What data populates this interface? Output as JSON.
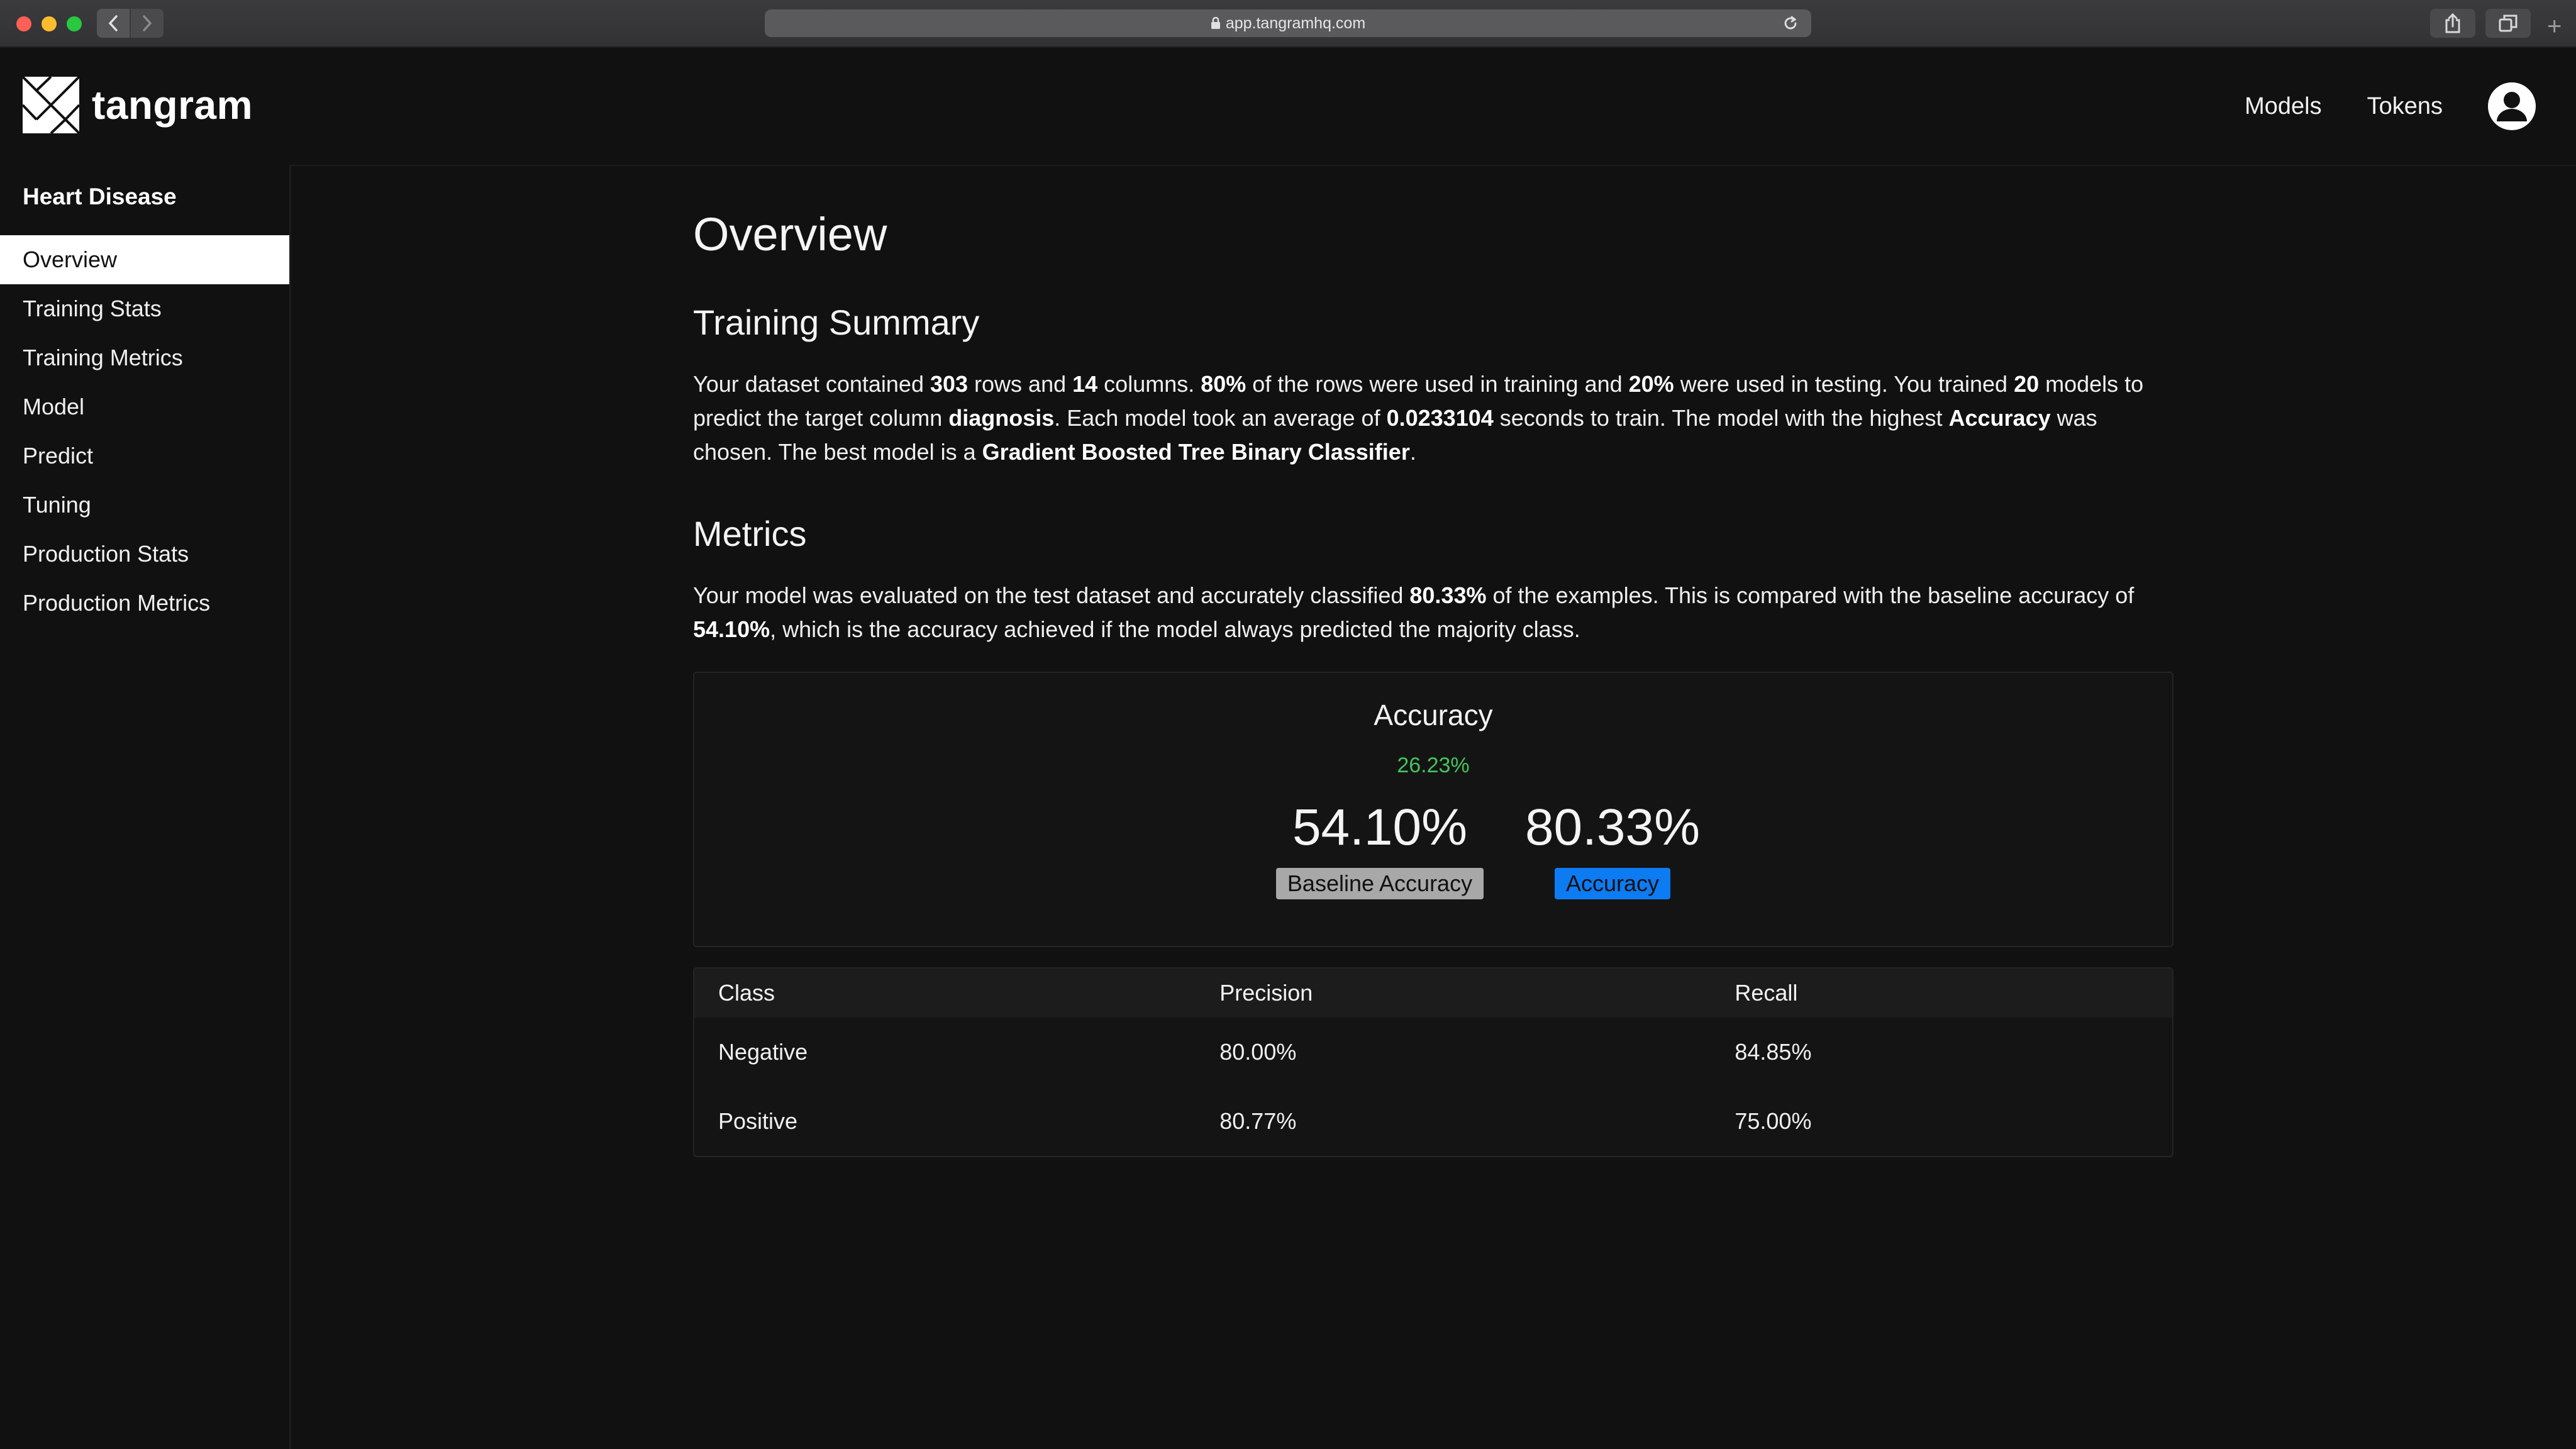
{
  "browser": {
    "url": "app.tangramhq.com"
  },
  "header": {
    "brand": "tangram",
    "nav": {
      "models": "Models",
      "tokens": "Tokens"
    }
  },
  "sidebar": {
    "title": "Heart Disease",
    "items": [
      {
        "label": "Overview",
        "active": true
      },
      {
        "label": "Training Stats"
      },
      {
        "label": "Training Metrics"
      },
      {
        "label": "Model"
      },
      {
        "label": "Predict"
      },
      {
        "label": "Tuning"
      },
      {
        "label": "Production Stats"
      },
      {
        "label": "Production Metrics"
      }
    ]
  },
  "main": {
    "title": "Overview",
    "training_summary": {
      "heading": "Training Summary",
      "t1": "Your dataset contained ",
      "rows": "303",
      "t2": " rows and ",
      "columns": "14",
      "t3": " columns. ",
      "train_pct": "80%",
      "t4": " of the rows were used in training and ",
      "test_pct": "20%",
      "t5": " were used in testing. You trained ",
      "models": "20",
      "t6": " models to predict the target column ",
      "target": "diagnosis",
      "t7": ". Each model took an average of ",
      "avg_time": "0.0233104",
      "t8": " seconds to train. The model with the highest ",
      "metric": "Accuracy",
      "t9": " was chosen. The best model is a ",
      "best_model": "Gradient Boosted Tree Binary Classifier",
      "t10": "."
    },
    "metrics": {
      "heading": "Metrics",
      "t1": "Your model was evaluated on the test dataset and accurately classified ",
      "accuracy": "80.33%",
      "t2": " of the examples. This is compared with the baseline accuracy of ",
      "baseline": "54.10%",
      "t3": ", which is the accuracy achieved if the model always predicted the majority class."
    },
    "accuracy_card": {
      "title": "Accuracy",
      "delta": "26.23%",
      "baseline_value": "54.10%",
      "baseline_label": "Baseline Accuracy",
      "accuracy_value": "80.33%",
      "accuracy_label": "Accuracy",
      "colors": {
        "delta": "#44c35a",
        "baseline_badge": "#a8a8a8",
        "accuracy_badge": "#0d7bf2"
      }
    },
    "class_table": {
      "headers": [
        "Class",
        "Precision",
        "Recall"
      ],
      "rows": [
        [
          "Negative",
          "80.00%",
          "84.85%"
        ],
        [
          "Positive",
          "80.77%",
          "75.00%"
        ]
      ]
    }
  }
}
